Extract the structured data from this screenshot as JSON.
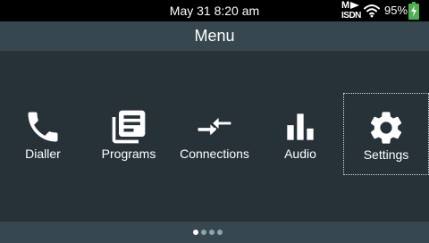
{
  "status_bar": {
    "time": "May 31 8:20 am",
    "network_badge_top": "M",
    "network_badge_bottom": "ISDN",
    "battery_percent": "95%",
    "wifi_icon": "wifi-icon",
    "battery_icon": "battery-charging-icon",
    "battery_color": "#4caf50"
  },
  "header": {
    "title": "Menu"
  },
  "menu": {
    "items": [
      {
        "label": "Dialler",
        "icon": "phone-icon"
      },
      {
        "label": "Programs",
        "icon": "programs-list-icon"
      },
      {
        "label": "Connections",
        "icon": "connections-arrows-icon"
      },
      {
        "label": "Audio",
        "icon": "audio-bars-icon"
      },
      {
        "label": "Settings",
        "icon": "gear-icon"
      }
    ],
    "focused_index": 4
  },
  "pager": {
    "page_count": 4,
    "current_page": 1
  },
  "colors": {
    "background": "#263238",
    "header_background": "#37474f",
    "status_bar_background": "#000000"
  }
}
